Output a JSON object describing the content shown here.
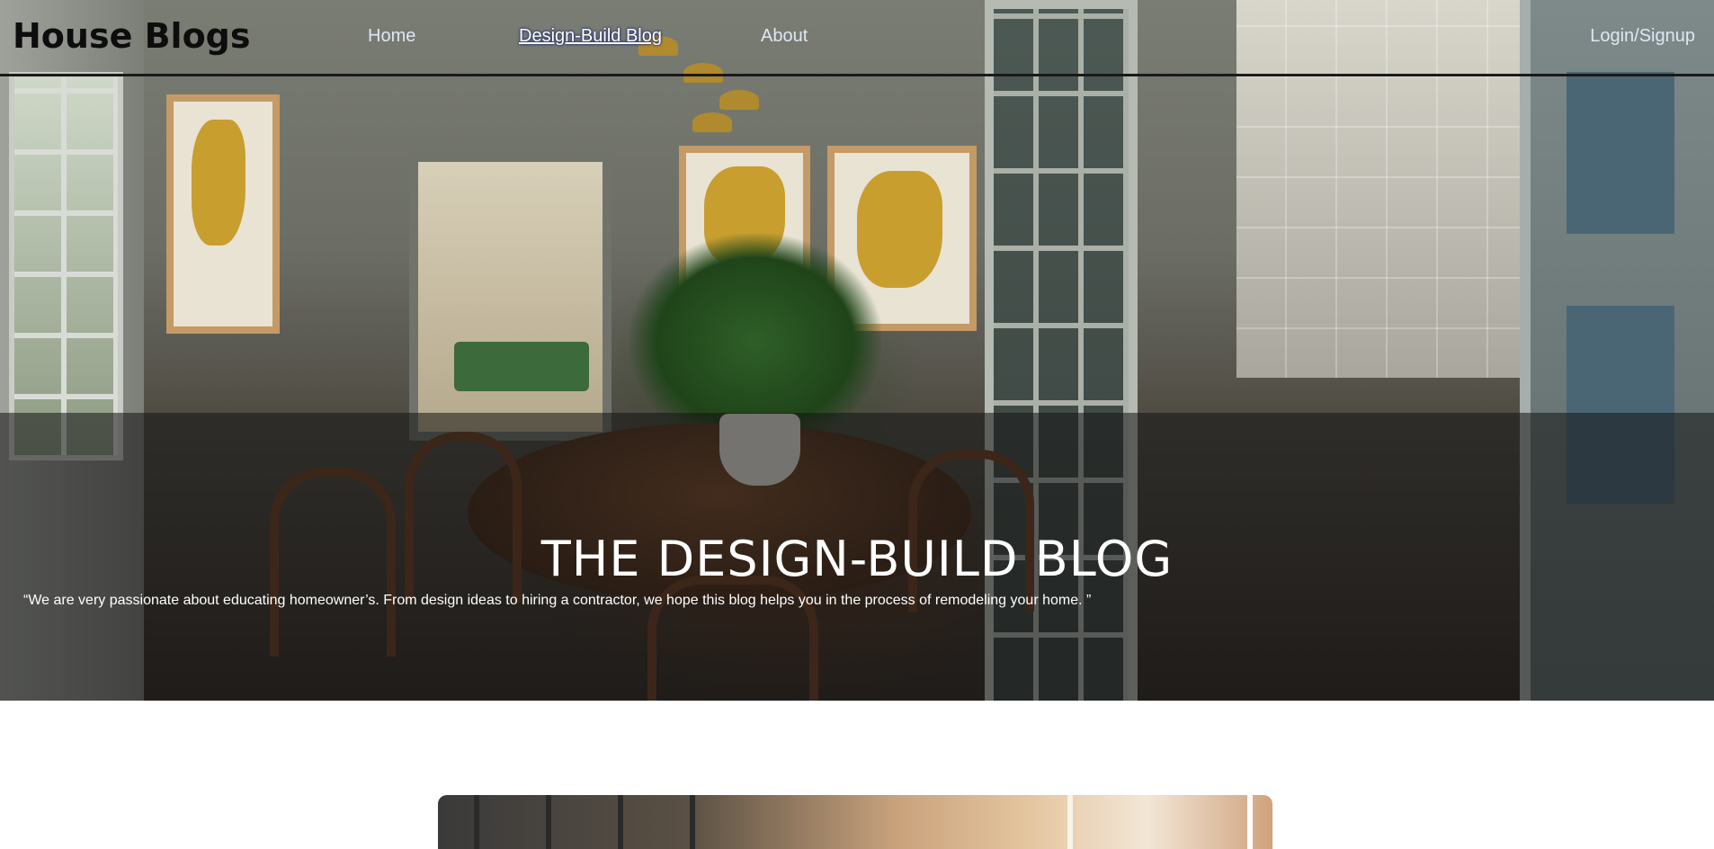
{
  "header": {
    "logo": "House Blogs",
    "nav": [
      {
        "label": "Home",
        "active": false
      },
      {
        "label": "Design-Build Blog",
        "active": true
      },
      {
        "label": "About",
        "active": false
      }
    ],
    "login_label": "Login/Signup"
  },
  "hero": {
    "title": "THE DESIGN-BUILD BLOG",
    "quote": "“We are very passionate about educating homeowner’s. From design ideas to hiring a contractor, we hope this blog helps you in the process of remodeling your home. ”"
  },
  "colors": {
    "nav_text": "#dfe6f2",
    "nav_border": "#1a1a1a",
    "hero_overlay": "rgba(20,20,20,0.55)",
    "page_background": "#ffffff"
  }
}
